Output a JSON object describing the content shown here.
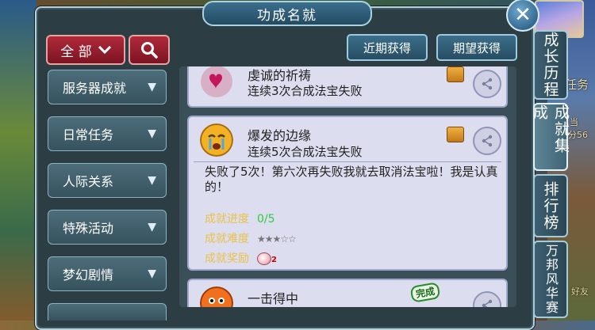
{
  "window": {
    "title": "功成名就"
  },
  "toolbar": {
    "filter_label": "全 部",
    "recent_label": "近期获得",
    "wish_label": "期望获得"
  },
  "categories": [
    {
      "label": "服务器成就"
    },
    {
      "label": "日常任务"
    },
    {
      "label": "人际关系"
    },
    {
      "label": "特殊活动"
    },
    {
      "label": "梦幻剧情"
    }
  ],
  "achievements": [
    {
      "name": "虔诚的祈祷",
      "desc": "连续3次合成法宝失败",
      "icon": "hearts-icon"
    },
    {
      "name": "爆发的边缘",
      "desc": "连续5次合成法宝失败",
      "icon": "crying-face-icon",
      "detail": "失败了5次！第六次再失败我就去取消法宝啦！我是认真的！",
      "progress_label": "成就进度",
      "progress_value": "0/5",
      "difficulty_label": "成就难度",
      "difficulty_stars": "★★★☆☆",
      "reward_label": "成就奖励",
      "reward_count": "2"
    },
    {
      "name": "一击得中",
      "icon": "angry-face-icon",
      "badge": "完成"
    }
  ],
  "side_tabs": [
    {
      "label": "成长历程"
    },
    {
      "label": "成就集成"
    },
    {
      "label": "排行榜"
    },
    {
      "label": "万邦风华赛"
    }
  ],
  "background": {
    "quest_text": "任务",
    "right_text_1": "当",
    "right_text_2": "分56",
    "right_text_3": "好友"
  },
  "colors": {
    "accent_red": "#9a1f2e",
    "panel_bg": "#2c3d44",
    "card_bg": "#ddddf0",
    "progress_green": "#2ecc40",
    "label_gold": "#e8c24a"
  }
}
